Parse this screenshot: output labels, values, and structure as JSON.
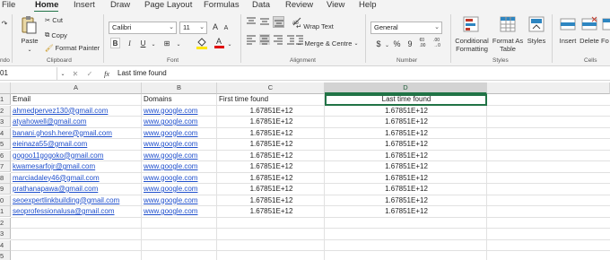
{
  "menu": {
    "tabs": [
      "File",
      "Home",
      "Insert",
      "Draw",
      "Page Layout",
      "Formulas",
      "Data",
      "Review",
      "View",
      "Help"
    ],
    "active": "Home"
  },
  "ribbon": {
    "clipboard": {
      "paste": "Paste",
      "cut": "Cut",
      "copy": "Copy",
      "format_painter": "Format Painter",
      "label": "Clipboard"
    },
    "font": {
      "name": "Calibri",
      "size": "11",
      "grow": "A",
      "shrink": "A",
      "bold": "B",
      "italic": "I",
      "underline": "U",
      "font_color_letter": "A",
      "label": "Font"
    },
    "alignment": {
      "wrap": "Wrap Text",
      "merge": "Merge & Centre",
      "label": "Alignment"
    },
    "number": {
      "format": "General",
      "currency": "$",
      "percent": "%",
      "comma": "9",
      "inc_dec": "€0\n.00",
      "dec_dec": ".00\n→0",
      "label": "Number"
    },
    "styles": {
      "conditional": "Conditional\nFormatting",
      "format_table": "Format As\nTable",
      "cell_styles": "Styles",
      "label": "Styles"
    },
    "cells": {
      "insert": "Insert",
      "delete": "Delete",
      "format": "Fo",
      "label": "Cells"
    },
    "undo_label": "ndo"
  },
  "formula_bar": {
    "namebox": "01",
    "fx": "fx",
    "value": "Last time found"
  },
  "grid": {
    "columns": [
      "A",
      "B",
      "C",
      "D"
    ],
    "selected_column": "D",
    "rows": [
      "1",
      "2",
      "3",
      "4",
      "5",
      "6",
      "7",
      "8",
      "9",
      "0",
      "1",
      "2",
      "3",
      "4",
      "5"
    ],
    "header": [
      "Email",
      "Domains",
      "First time found",
      "Last time found"
    ],
    "data": [
      [
        "ahmedpervez130@gmail.com",
        "www.google.com",
        "1.67851E+12",
        "1.67851E+12"
      ],
      [
        "atyahowell@gmail.com",
        "www.google.com",
        "1.67851E+12",
        "1.67851E+12"
      ],
      [
        "banani.ghosh.here@gmail.com",
        "www.google.com",
        "1.67851E+12",
        "1.67851E+12"
      ],
      [
        "eieinaza55@gmail.com",
        "www.google.com",
        "1.67851E+12",
        "1.67851E+12"
      ],
      [
        "gogoo11gogoko@gmail.com",
        "www.google.com",
        "1.67851E+12",
        "1.67851E+12"
      ],
      [
        "kwamesarfojr@gmail.com",
        "www.google.com",
        "1.67851E+12",
        "1.67851E+12"
      ],
      [
        "marciadaley46@gmail.com",
        "www.google.com",
        "1.67851E+12",
        "1.67851E+12"
      ],
      [
        "prathanapawa@gmail.com",
        "www.google.com",
        "1.67851E+12",
        "1.67851E+12"
      ],
      [
        "seoexpertlinkbuilding@gmail.com",
        "www.google.com",
        "1.67851E+12",
        "1.67851E+12"
      ],
      [
        "seoprofessionalusa@gmail.com",
        "www.google.com",
        "1.67851E+12",
        "1.67851E+12"
      ]
    ]
  },
  "colors": {
    "accent": "#217346",
    "link": "#1f4fcc"
  }
}
